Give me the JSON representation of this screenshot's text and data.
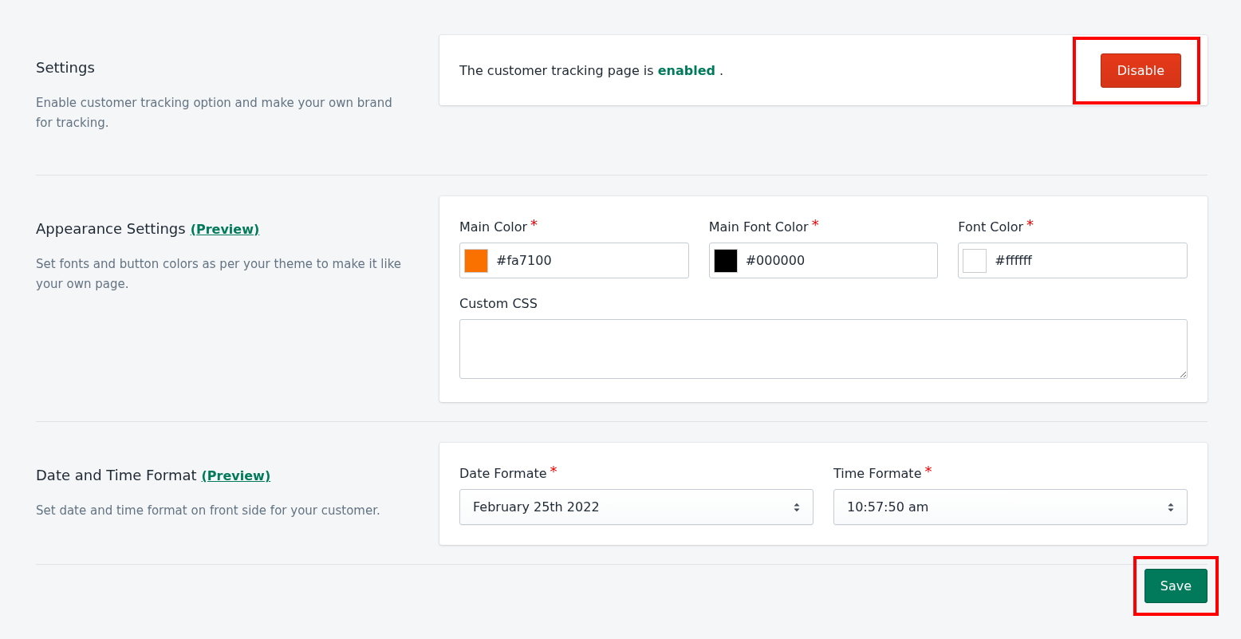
{
  "sections": [
    {
      "kind": "status",
      "title": "Settings",
      "description": "Enable customer tracking option and make your own brand for tracking.",
      "status_text": "The customer tracking page is **enabled** .",
      "button": {
        "label": "Disable",
        "highlighted": true
      }
    },
    {
      "kind": "appearance",
      "title": "Appearance Settings",
      "preview_link": "(Preview)",
      "description": "Set fonts and button colors as per your theme to make it like your own page.",
      "color_fields": [
        {
          "label": "Main Color",
          "required": "*",
          "value": "#fa7100",
          "color": "#fa7100"
        },
        {
          "label": "Main Font Color",
          "required": "*",
          "value": "#000000",
          "color": "#000000"
        },
        {
          "label": "Font Color",
          "required": "*",
          "value": "#ffffff",
          "color": "#ffffff"
        }
      ],
      "css_field": {
        "label": "Custom CSS"
      }
    },
    {
      "kind": "datetime",
      "title": "Date and Time Format",
      "preview_link": "(Preview)",
      "description": "Set date and time format on front side for your customer.",
      "selects": [
        {
          "label": "Date Formate",
          "required": "*",
          "value": "February 25th 2022"
        },
        {
          "label": "Time Formate",
          "required": "*",
          "value": "10:57:50 am"
        }
      ]
    }
  ],
  "save_button": {
    "label": "Save",
    "highlighted": true
  }
}
